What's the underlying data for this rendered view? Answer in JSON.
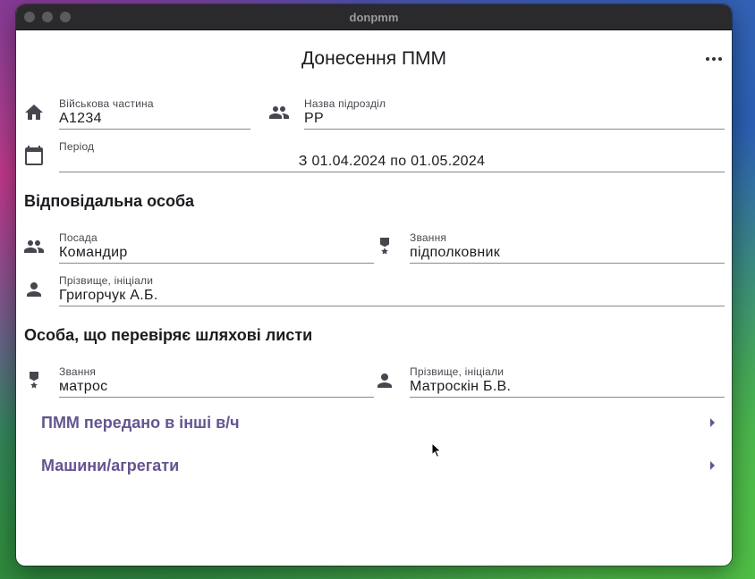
{
  "window": {
    "title": "donpmm"
  },
  "page": {
    "title": "Донесення ПММ",
    "more_icon": "more-horiz-icon"
  },
  "unit": {
    "military_unit": {
      "label": "Військова частина",
      "value": "А1234",
      "icon": "home-icon"
    },
    "subdivision": {
      "label": "Назва підрозділ",
      "value": "РР",
      "icon": "group-icon"
    },
    "period": {
      "label": "Період",
      "value": "З 01.04.2024 по 01.05.2024",
      "icon": "calendar-icon"
    }
  },
  "responsible": {
    "heading": "Відповідальна особа",
    "position": {
      "label": "Посада",
      "value": "Командир",
      "icon": "group-icon"
    },
    "rank": {
      "label": "Звання",
      "value": "підполковник",
      "icon": "military-medal-icon"
    },
    "name": {
      "label": "Прізвище, ініціали",
      "value": "Григорчук А.Б.",
      "icon": "person-icon"
    }
  },
  "checker": {
    "heading": "Особа, що перевіряє шляхові листи",
    "rank": {
      "label": "Звання",
      "value": "матрос",
      "icon": "military-medal-icon"
    },
    "name": {
      "label": "Прізвище, ініціали",
      "value": "Матроскін Б.В.",
      "icon": "person-icon"
    }
  },
  "nav": [
    {
      "label": "ПММ передано в інші в/ч",
      "icon": "chevron-right-icon"
    },
    {
      "label": "Машини/агрегати",
      "icon": "chevron-right-icon"
    }
  ],
  "colors": {
    "accent": "#65558f",
    "text": "#1d1b20",
    "titlebar": "#2a2a2c"
  }
}
